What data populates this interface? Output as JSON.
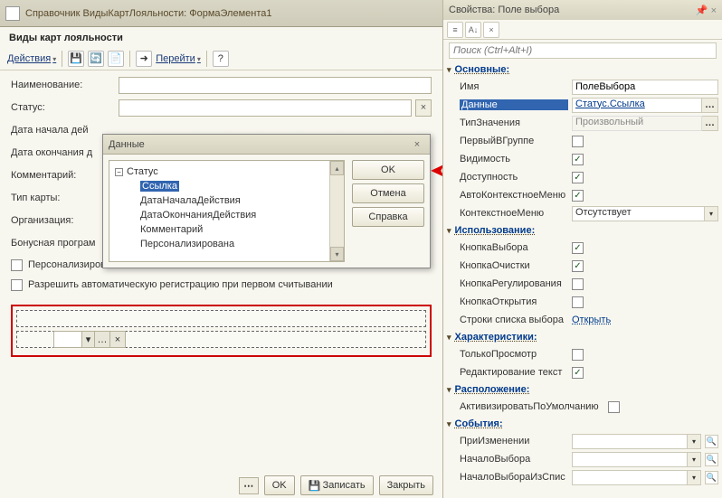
{
  "window": {
    "title": "Справочник ВидыКартЛояльности: ФормаЭлемента1"
  },
  "form": {
    "header": "Виды карт лояльности",
    "toolbar": {
      "actions": "Действия",
      "goto": "Перейти"
    },
    "fields": {
      "name_label": "Наименование:",
      "status_label": "Статус:",
      "date_start_label": "Дата начала дей",
      "date_end_label": "Дата окончания д",
      "comment_label": "Комментарий:",
      "card_type_label": "Тип карты:",
      "org_label": "Организация:",
      "bonus_label": "Бонусная програм"
    },
    "checkboxes": {
      "personalized": "Персонализирована",
      "allow_auto": "Разрешить автоматическую регистрацию при первом считывании"
    },
    "buttons": {
      "ok": "OK",
      "save": "Записать",
      "close": "Закрыть"
    }
  },
  "dialog": {
    "title": "Данные",
    "tree": {
      "root": "Статус",
      "selected": "Ссылка",
      "items": [
        "ДатаНачалаДействия",
        "ДатаОкончанияДействия",
        "Комментарий",
        "Персонализирована"
      ]
    },
    "buttons": {
      "ok": "OK",
      "cancel": "Отмена",
      "help": "Справка"
    }
  },
  "props": {
    "title": "Свойства: Поле выбора",
    "search_placeholder": "Поиск (Ctrl+Alt+I)",
    "sections": {
      "main": "Основные:",
      "usage": "Использование:",
      "chars": "Характеристики:",
      "layout": "Расположение:",
      "events": "События:"
    },
    "rows": {
      "name_label": "Имя",
      "name_value": "ПолеВыбора",
      "data_label": "Данные",
      "data_value": "Статус.Ссылка",
      "type_label": "ТипЗначения",
      "type_value": "Произвольный",
      "first_in_group": "ПервыйВГруппе",
      "visibility": "Видимость",
      "availability": "Доступность",
      "autocontext": "АвтоКонтекстноеМеню",
      "context_menu_label": "КонтекстноеМеню",
      "context_menu_value": "Отсутствует",
      "select_button": "КнопкаВыбора",
      "clear_button": "КнопкаОчистки",
      "regulate_button": "КнопкаРегулирования",
      "open_button": "КнопкаОткрытия",
      "list_rows_label": "Строки списка выбора",
      "list_rows_value": "Открыть",
      "readonly": "ТолькоПросмотр",
      "edit_text": "Редактирование текст",
      "activate_default": "АктивизироватьПоУмолчанию",
      "on_change": "ПриИзменении",
      "start_choice": "НачалоВыбора",
      "start_choice_list": "НачалоВыбораИзСпис"
    }
  }
}
